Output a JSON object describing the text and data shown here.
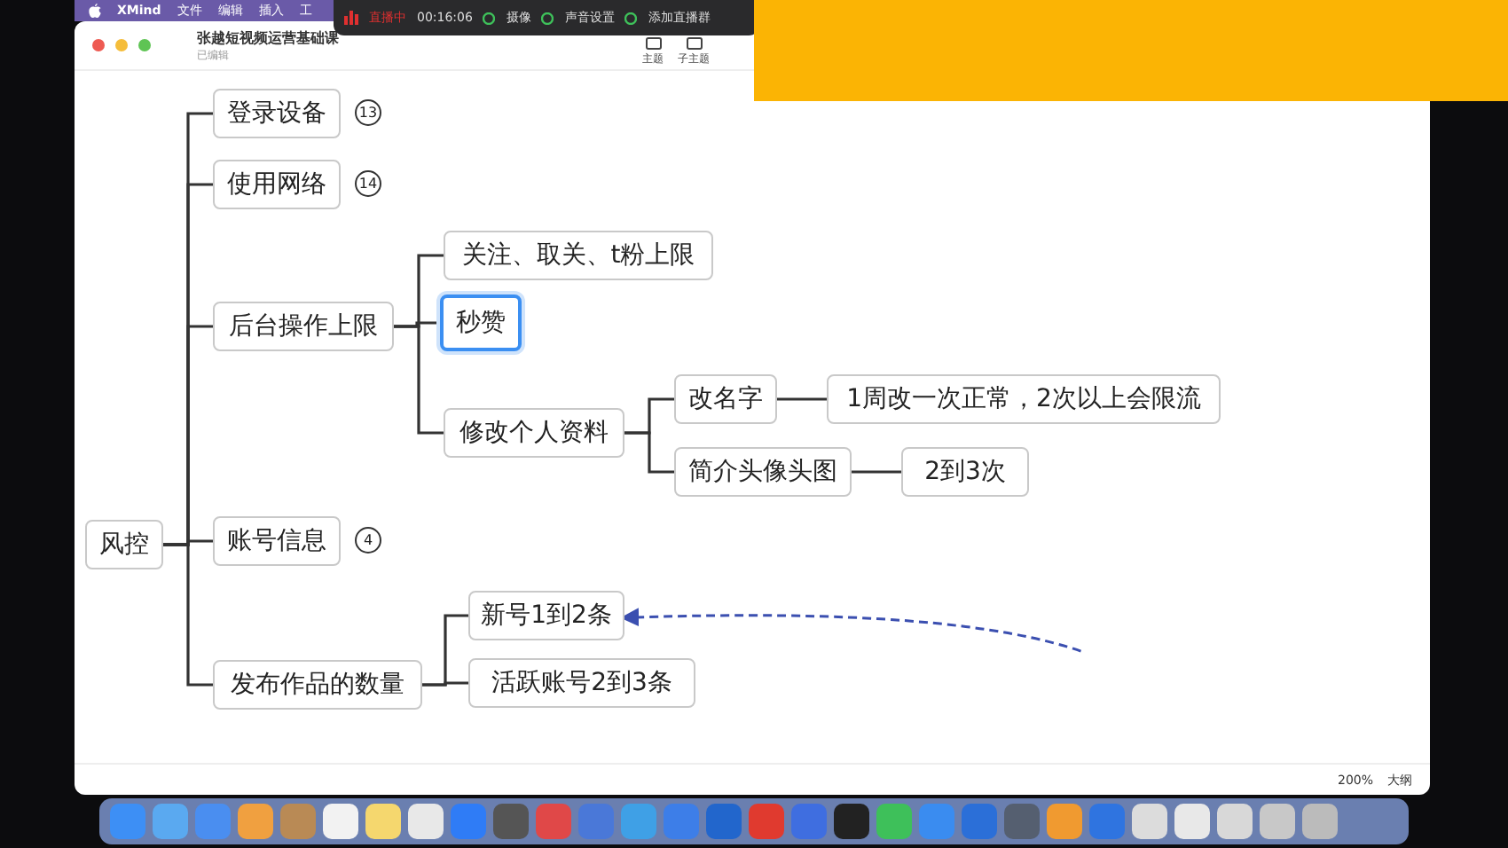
{
  "menu_bar": {
    "app": "XMind",
    "items": [
      "文件",
      "编辑",
      "插入",
      "工"
    ]
  },
  "recording_bar": {
    "status": "直播中",
    "time": "00:16:06",
    "items": [
      "摄像",
      "声音设置",
      "添加直播群"
    ]
  },
  "window": {
    "title": "张越短视频运营基础课",
    "subtitle": "已编辑",
    "toolbar": [
      "主题",
      "子主题"
    ]
  },
  "mind_map": {
    "root": {
      "label": "风控",
      "selected": false,
      "children": [
        {
          "label": "登录设备",
          "selected": false,
          "collapsed_count": "13"
        },
        {
          "label": "使用网络",
          "selected": false,
          "collapsed_count": "14"
        },
        {
          "label": "后台操作上限",
          "selected": false,
          "children": [
            {
              "label": "关注、取关、t粉上限",
              "selected": false
            },
            {
              "label": "秒赞",
              "selected": true
            },
            {
              "label": "修改个人资料",
              "selected": false,
              "children": [
                {
                  "label": "改名字",
                  "selected": false,
                  "children": [
                    {
                      "label": "1周改一次正常，2次以上会限流",
                      "selected": false
                    }
                  ]
                },
                {
                  "label": "简介头像头图",
                  "selected": false,
                  "children": [
                    {
                      "label": "2到3次",
                      "selected": false
                    }
                  ]
                }
              ]
            }
          ]
        },
        {
          "label": "账号信息",
          "selected": false,
          "collapsed_count": "4"
        },
        {
          "label": "发布作品的数量",
          "selected": false,
          "children": [
            {
              "label": "新号1到2条",
              "selected": false
            },
            {
              "label": "活跃账号2到3条",
              "selected": false
            }
          ]
        }
      ]
    }
  },
  "status_bar": {
    "zoom": "200%",
    "outline": "大纲"
  }
}
